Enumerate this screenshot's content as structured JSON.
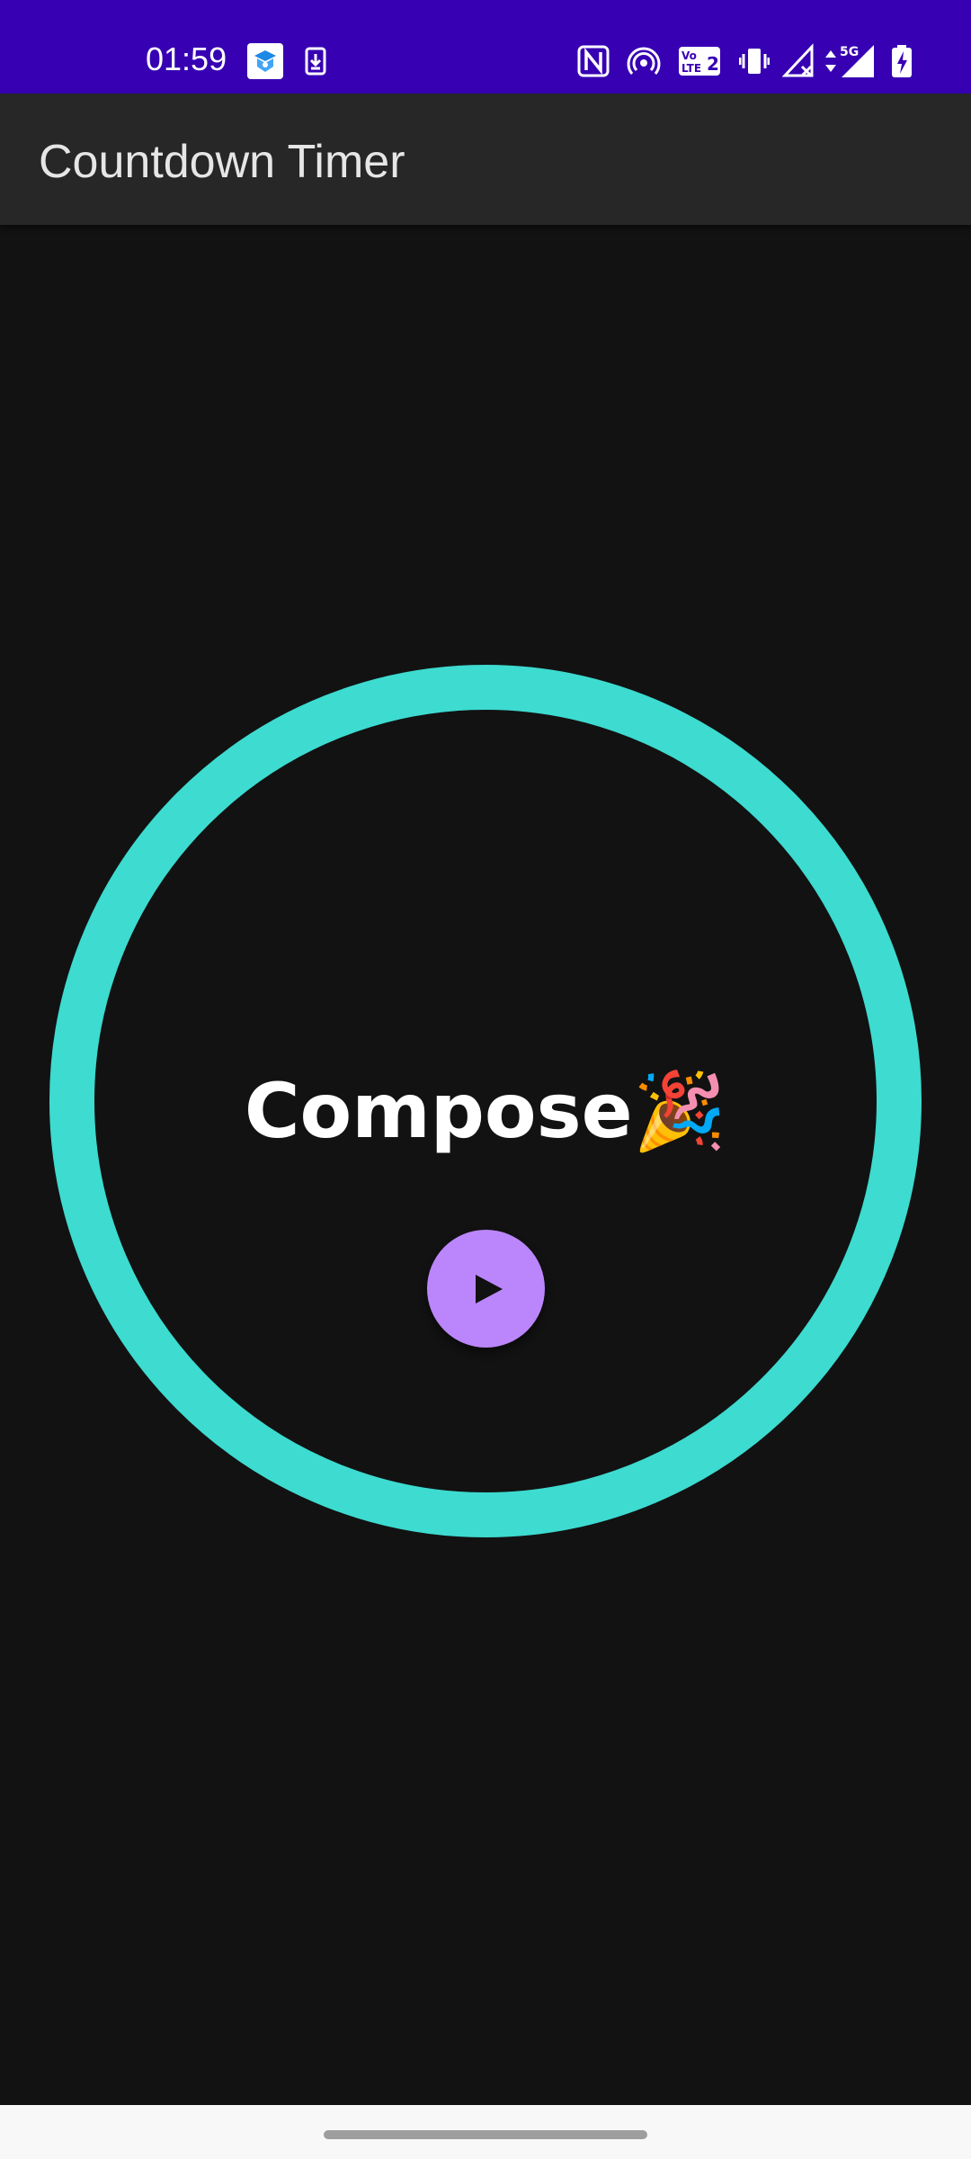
{
  "status_bar": {
    "time": "01:59",
    "background": "#3700b3",
    "left_icons": [
      "vpn-shield-icon",
      "download-phone-icon"
    ],
    "right_icons": [
      "nfc-icon",
      "hotspot-icon",
      "volte-icon",
      "vibrate-icon",
      "signal-no-sim-icon",
      "data-arrows-icon",
      "signal-5g-icon",
      "battery-charging-icon"
    ],
    "network_label": "5G",
    "volte_label": "VoLTE 2"
  },
  "app_bar": {
    "title": "Countdown Timer",
    "background": "#272727"
  },
  "timer": {
    "label": "Compose🎉",
    "ring_color": "#3ddbd0",
    "progress": 1.0,
    "play_button_color": "#bb86fc",
    "play_icon": "play-arrow-icon"
  },
  "nav_bar": {
    "background": "#f8f8f8",
    "handle_icon": "gesture-handle"
  }
}
